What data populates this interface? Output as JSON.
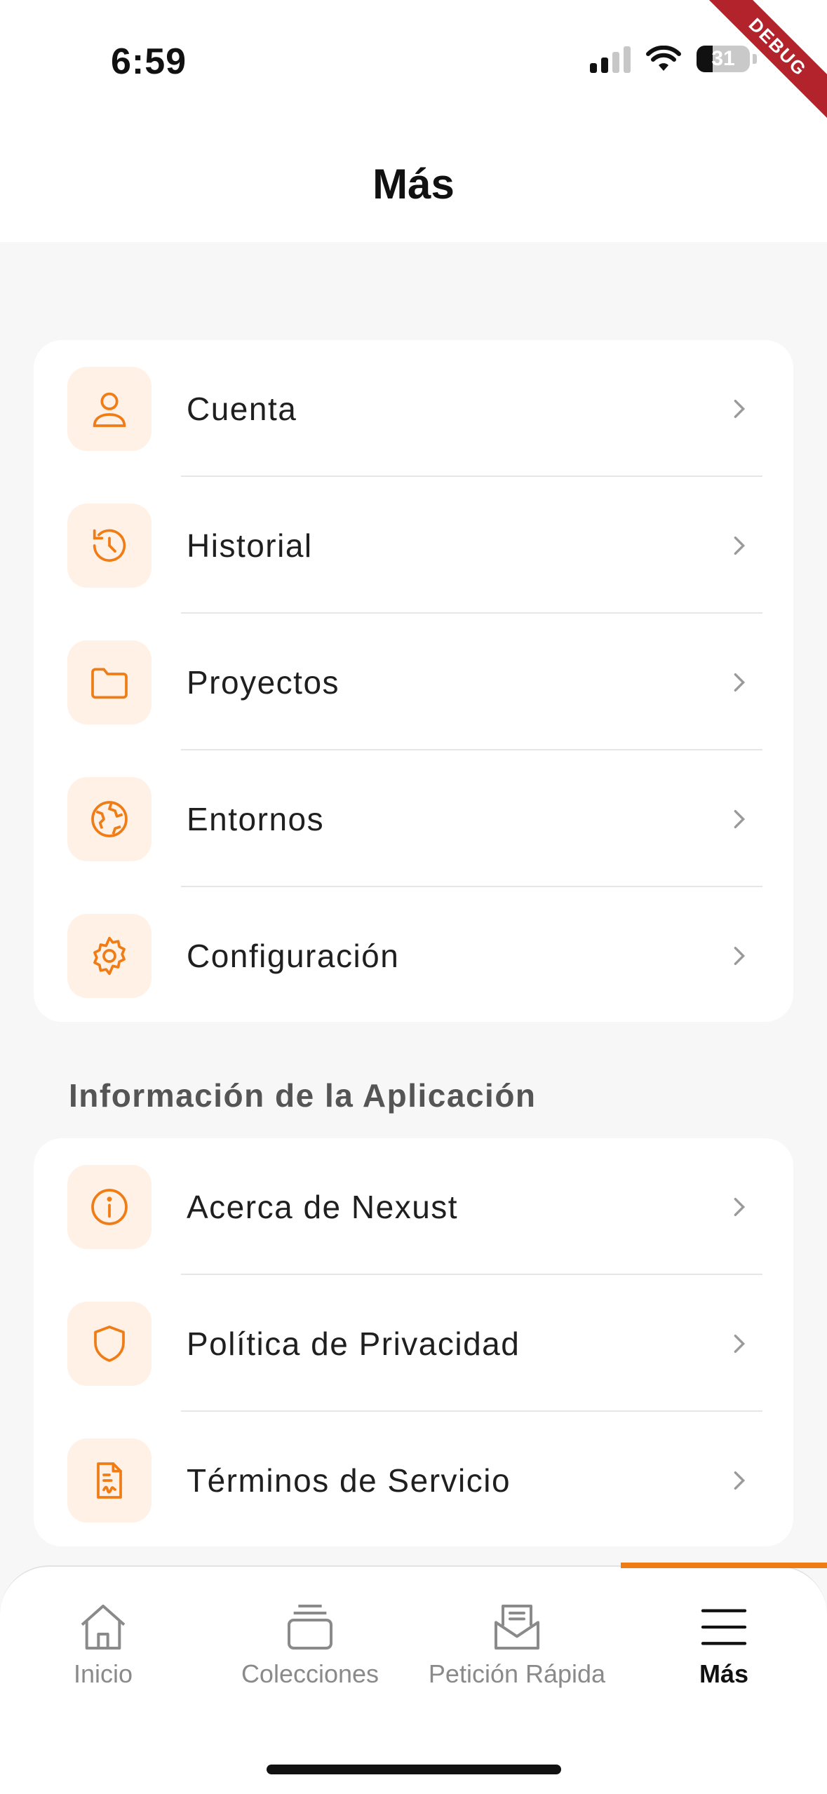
{
  "status_bar": {
    "time": "6:59",
    "battery": "31"
  },
  "debug_banner": "DEBUG",
  "header": {
    "title": "Más"
  },
  "main_menu": [
    {
      "label": "Cuenta",
      "icon": "user-icon"
    },
    {
      "label": "Historial",
      "icon": "history-icon"
    },
    {
      "label": "Proyectos",
      "icon": "folder-icon"
    },
    {
      "label": "Entornos",
      "icon": "globe-icon"
    },
    {
      "label": "Configuración",
      "icon": "gear-icon"
    }
  ],
  "app_info": {
    "title": "Información de la Aplicación",
    "items": [
      {
        "label": "Acerca de Nexust",
        "icon": "info-icon"
      },
      {
        "label": "Política de Privacidad",
        "icon": "shield-icon"
      },
      {
        "label": "Términos de Servicio",
        "icon": "document-icon"
      }
    ]
  },
  "tabbar": {
    "tabs": [
      {
        "label": "Inicio",
        "icon": "home-icon"
      },
      {
        "label": "Colecciones",
        "icon": "collections-icon"
      },
      {
        "label": "Petición Rápida",
        "icon": "mail-icon"
      },
      {
        "label": "Más",
        "icon": "menu-icon"
      }
    ],
    "active": "Más"
  },
  "colors": {
    "accent": "#f07c16",
    "icon_bg": "#fff1e6",
    "background": "#f7f7f7"
  }
}
